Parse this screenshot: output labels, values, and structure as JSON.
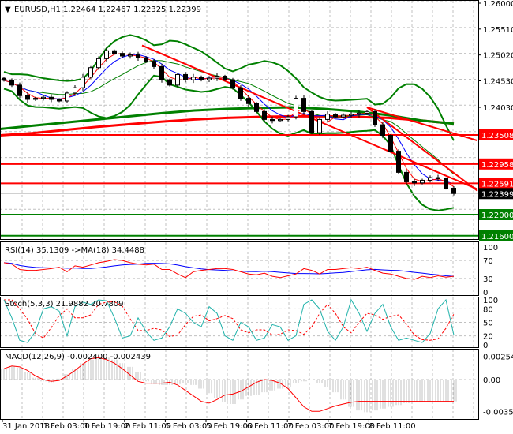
{
  "header": {
    "symbol": "EURUSD,H1",
    "ohlc": "1.22464 1.22467 1.22325 1.22399"
  },
  "price_axis": [
    "1.26000",
    "1.25510",
    "1.25020",
    "1.24530",
    "1.24030"
  ],
  "levels": [
    {
      "price": 1.23508,
      "label": "1.23508",
      "color": "#ff0000"
    },
    {
      "price": 1.22958,
      "label": "1.22958",
      "color": "#ff0000"
    },
    {
      "price": 1.22591,
      "label": "1.22591",
      "color": "#ff0000"
    },
    {
      "price": 1.22,
      "label": "1.22000",
      "color": "#008000"
    },
    {
      "price": 1.216,
      "label": "1.21600",
      "color": "#008000"
    }
  ],
  "current_price": {
    "price": 1.22399,
    "label": "1.22399"
  },
  "time_axis": [
    "31 Jan 2018",
    "1 Feb 03:00",
    "1 Feb 19:00",
    "2 Feb 11:00",
    "5 Feb 03:00",
    "5 Feb 19:00",
    "6 Feb 11:00",
    "7 Feb 03:00",
    "7 Feb 19:00",
    "8 Feb 11:00"
  ],
  "rsi": {
    "title": "RSI(14) 35.1309  ->MA(18) 34.4488",
    "ticks": [
      "100",
      "70",
      "30",
      "0"
    ]
  },
  "stoch": {
    "title": "Stoch(5,3,3) 21.9882 20.7809",
    "ticks": [
      "100",
      "80",
      "50",
      "20",
      "0"
    ]
  },
  "macd": {
    "title": "MACD(12,26,9) -0.002400 -0.002439",
    "ticks": [
      "0.002544",
      "0.00",
      "-0.003543"
    ]
  },
  "chart_data": {
    "type": "line",
    "title": "EURUSD,H1",
    "ylim": [
      1.2155,
      1.2605
    ],
    "closes": [
      1.2454,
      1.2445,
      1.2425,
      1.2418,
      1.242,
      1.2422,
      1.2418,
      1.2415,
      1.243,
      1.244,
      1.246,
      1.2478,
      1.2495,
      1.251,
      1.2505,
      1.25,
      1.2502,
      1.2497,
      1.249,
      1.248,
      1.2455,
      1.2445,
      1.2465,
      1.2455,
      1.246,
      1.2455,
      1.2458,
      1.2462,
      1.2455,
      1.244,
      1.242,
      1.241,
      1.2395,
      1.238,
      1.2378,
      1.238,
      1.2385,
      1.242,
      1.2395,
      1.2355,
      1.238,
      1.239,
      1.2385,
      1.2388,
      1.239,
      1.2392,
      1.2395,
      1.237,
      1.235,
      1.232,
      1.228,
      1.2262,
      1.226,
      1.2265,
      1.227,
      1.2268,
      1.225,
      1.224
    ],
    "ma_long_green": [
      1.2362,
      1.2368,
      1.2374,
      1.238,
      1.2386,
      1.2392,
      1.2397,
      1.24,
      1.2402,
      1.2403,
      1.24,
      1.2395,
      1.2388,
      1.2378,
      1.2372
    ],
    "ma_long_red": [
      1.235,
      1.2354,
      1.236,
      1.2366,
      1.2371,
      1.2376,
      1.238,
      1.2383,
      1.2385,
      1.2386,
      1.2386,
      1.2385,
      1.2383,
      1.2378,
      1.2372
    ],
    "trendlines": [
      {
        "from": [
          17.5,
          1.252
        ],
        "to": [
          60,
          1.2248
        ],
        "color": "#ff0000"
      },
      {
        "from": [
          46,
          1.2403
        ],
        "to": [
          60,
          1.234
        ],
        "color": "#ff0000"
      },
      {
        "from": [
          46,
          1.2403
        ],
        "to": [
          60,
          1.2245
        ],
        "color": "#ff0000"
      }
    ],
    "rsi": [
      65,
      62,
      50,
      48,
      48,
      50,
      52,
      55,
      45,
      58,
      55,
      60,
      65,
      68,
      72,
      70,
      65,
      62,
      60,
      62,
      50,
      50,
      40,
      32,
      45,
      48,
      50,
      52,
      52,
      50,
      45,
      40,
      38,
      42,
      35,
      32,
      36,
      40,
      52,
      48,
      40,
      50,
      50,
      52,
      54,
      52,
      55,
      48,
      42,
      40,
      35,
      30,
      28,
      35,
      32,
      36,
      33,
      35
    ],
    "stoch": [
      100,
      60,
      10,
      5,
      30,
      80,
      85,
      75,
      20,
      85,
      95,
      90,
      100,
      98,
      60,
      15,
      20,
      60,
      30,
      10,
      15,
      40,
      80,
      70,
      50,
      40,
      85,
      70,
      20,
      10,
      50,
      40,
      10,
      15,
      45,
      40,
      10,
      20,
      90,
      100,
      80,
      30,
      10,
      40,
      100,
      70,
      30,
      70,
      90,
      40,
      10,
      15,
      10,
      5,
      25,
      80,
      100,
      22
    ],
    "macd_main": [
      0.0012,
      0.0015,
      0.0013,
      0.0008,
      0.0002,
      -0.0002,
      -0.0003,
      0.0001,
      0.0006,
      0.0012,
      0.0018,
      0.0022,
      0.0025,
      0.0024,
      0.0022,
      0.0018,
      0.0014,
      0.0008,
      -0.0002,
      -0.0005,
      -0.0006,
      -0.0006,
      -0.0005,
      -0.0004,
      -0.0006,
      -0.001,
      -0.0015,
      -0.002,
      -0.0025,
      -0.0027,
      -0.0022,
      -0.0018,
      -0.0017,
      -0.0014,
      -0.0012,
      -0.001,
      -0.0008,
      -0.0004,
      -0.0002,
      0.0,
      -0.0004,
      -0.0008,
      -0.0014,
      -0.0022,
      -0.003,
      -0.0034,
      -0.0036,
      -0.0034,
      -0.0032,
      -0.003,
      -0.0028,
      -0.0026,
      -0.0025,
      -0.0024,
      -0.0024,
      -0.0024,
      -0.0024,
      -0.0024
    ],
    "macd_signal": [
      0.0012,
      0.0015,
      0.0014,
      0.001,
      0.0004,
      0.0,
      -0.0002,
      -0.0001,
      0.0004,
      0.001,
      0.0017,
      0.0023,
      0.0024,
      0.0022,
      0.0018,
      0.0012,
      0.0005,
      -0.0002,
      -0.0004,
      -0.0004,
      -0.0004,
      -0.0003,
      -0.0006,
      -0.0012,
      -0.0018,
      -0.0024,
      -0.0026,
      -0.0022,
      -0.0017,
      -0.0016,
      -0.0013,
      -0.0008,
      -0.0003,
      0.0,
      -0.0001,
      -0.0004,
      -0.001,
      -0.002,
      -0.003,
      -0.0035,
      -0.0035,
      -0.0032,
      -0.0029,
      -0.0027,
      -0.0025,
      -0.0024,
      -0.0024,
      -0.0024,
      -0.0024,
      -0.0024,
      -0.0024,
      -0.0024,
      -0.0024,
      -0.0024,
      -0.0024,
      -0.0024,
      -0.0024,
      -0.0024
    ]
  }
}
